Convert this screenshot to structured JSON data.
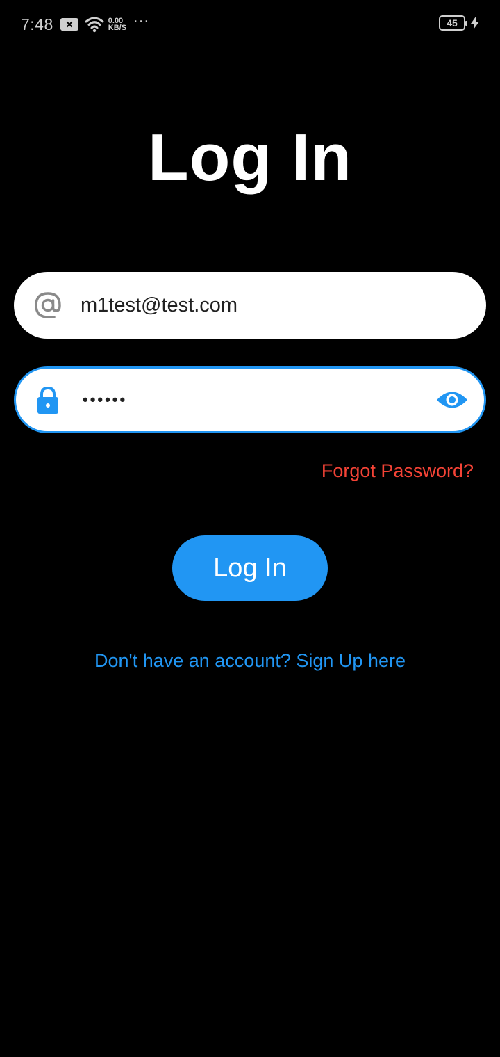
{
  "status_bar": {
    "time": "7:48",
    "speed_value": "0.00",
    "speed_unit": "KB/S",
    "more": "···",
    "battery_level": "45"
  },
  "page": {
    "title": "Log In"
  },
  "email_field": {
    "value": "m1test@test.com",
    "icon": "at-icon"
  },
  "password_field": {
    "value": "••••••",
    "icon": "lock-icon",
    "toggle_icon": "eye-icon"
  },
  "forgot_password_label": "Forgot Password?",
  "login_button_label": "Log In",
  "signup_link_label": "Don't have an account? Sign Up here",
  "colors": {
    "background": "#000000",
    "accent": "#2196f3",
    "danger": "#f44336",
    "field": "#ffffff"
  }
}
